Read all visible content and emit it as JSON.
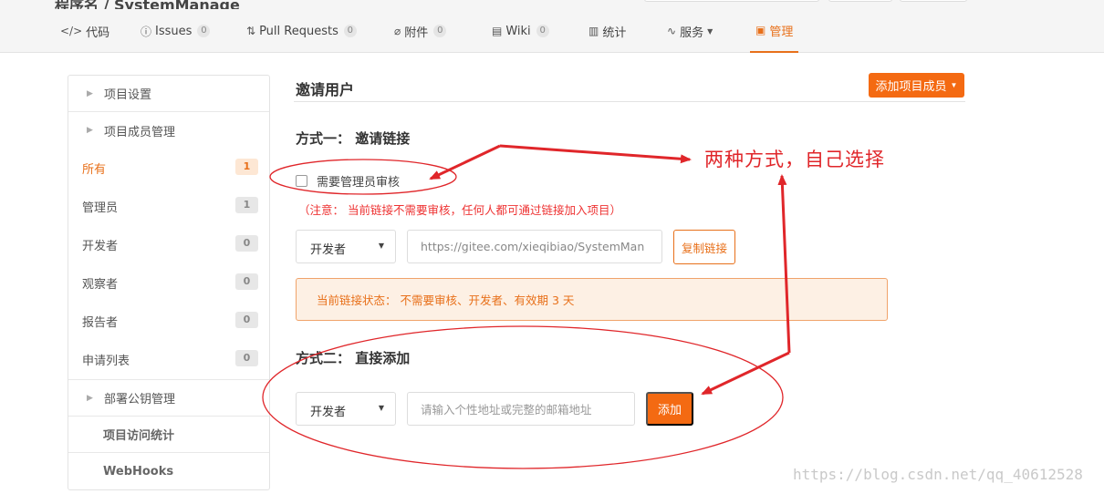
{
  "breadcrumb": "程序名 / SystemManage",
  "tabs": [
    {
      "icon": "code-icon",
      "glyph": "</>",
      "label": "代码",
      "count": ""
    },
    {
      "icon": "issue-icon",
      "glyph": "ⓘ",
      "label": "Issues",
      "count": "0"
    },
    {
      "icon": "pull-request-icon",
      "glyph": "⇅",
      "label": "Pull Requests",
      "count": "0"
    },
    {
      "icon": "paperclip-icon",
      "glyph": "⌀",
      "label": "附件",
      "count": "0"
    },
    {
      "icon": "wiki-icon",
      "glyph": "▤",
      "label": "Wiki",
      "count": "0"
    },
    {
      "icon": "bar-chart-icon",
      "glyph": "▥",
      "label": "统计",
      "count": ""
    },
    {
      "icon": "pulse-icon",
      "glyph": "∿",
      "label": "服务",
      "count": ""
    },
    {
      "icon": "manage-icon",
      "glyph": "▣",
      "label": "管理",
      "count": ""
    }
  ],
  "sidebar": {
    "project_settings": "项目设置",
    "member_management": "项目成员管理",
    "items": [
      {
        "label": "所有",
        "count": "1"
      },
      {
        "label": "管理员",
        "count": "1"
      },
      {
        "label": "开发者",
        "count": "0"
      },
      {
        "label": "观察者",
        "count": "0"
      },
      {
        "label": "报告者",
        "count": "0"
      },
      {
        "label": "申请列表",
        "count": "0"
      }
    ],
    "deploy_keys": "部署公钥管理",
    "access_stats": "项目访问统计",
    "webhooks": "WebHooks"
  },
  "main": {
    "title": "邀请用户",
    "add_member_button": "添加项目成员",
    "method_one": "方式一：  邀请链接",
    "require_approval_label": "需要管理员审核",
    "note": "（注意：  当前链接不需要审核，任何人都可通过链接加入项目）",
    "link_role": "开发者",
    "link_url": "https://gitee.com/xieqibiao/SystemMan",
    "copy_button": "复制链接",
    "link_status": "当前链接状态：  不需要审核、开发者、有效期 3 天",
    "method_two": "方式二：  直接添加",
    "add_role": "开发者",
    "add_placeholder": "请输入个性地址或完整的邮箱地址",
    "add_button": "添加"
  },
  "annotation": {
    "text": "两种方式，自己选择",
    "color": "#e0262a"
  },
  "watermark": "https://blog.csdn.net/qq_40612528",
  "colors": {
    "accent": "#f46a12",
    "accent_text": "#e8701a",
    "note_red": "#e33"
  }
}
